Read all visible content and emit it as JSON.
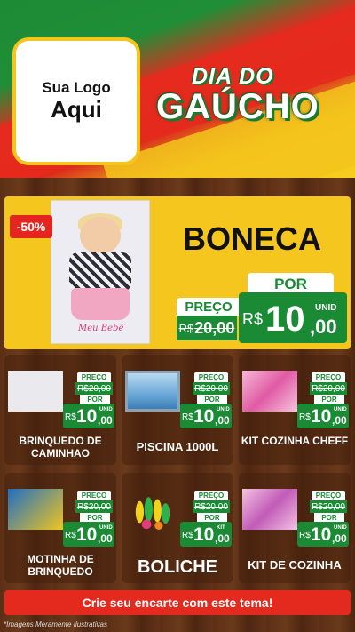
{
  "header": {
    "logo_line1": "Sua Logo",
    "logo_line2": "Aqui",
    "title_line1": "DIA DO",
    "title_line2": "GAÚCHO"
  },
  "hero": {
    "discount": "-50%",
    "name": "BONECA",
    "brand_text": "Meu Bebê",
    "preco_label": "PREÇO",
    "old_currency": "R$",
    "old_price": "20,00",
    "por_label": "POR",
    "currency": "R$",
    "price_int": "10",
    "price_cents": ",00",
    "unit": "UNID"
  },
  "cards": [
    {
      "name": "BRINQUEDO DE CAMINHAO",
      "preco_label": "PREÇO",
      "old_currency": "R$",
      "old_price": "20,00",
      "por_label": "POR",
      "currency": "R$",
      "price_int": "10",
      "price_cents": ",00",
      "unit": "UNID"
    },
    {
      "name": "PISCINA 1000L",
      "preco_label": "PREÇO",
      "old_currency": "R$",
      "old_price": "20,00",
      "por_label": "POR",
      "currency": "R$",
      "price_int": "10",
      "price_cents": ",00",
      "unit": "UNID"
    },
    {
      "name": "KIT COZINHA CHEFF",
      "preco_label": "PREÇO",
      "old_currency": "R$",
      "old_price": "20,00",
      "por_label": "POR",
      "currency": "R$",
      "price_int": "10",
      "price_cents": ",00",
      "unit": "UNID"
    },
    {
      "name": "MOTINHA DE BRINQUEDO",
      "preco_label": "PREÇO",
      "old_currency": "R$",
      "old_price": "20,00",
      "por_label": "POR",
      "currency": "R$",
      "price_int": "10",
      "price_cents": ",00",
      "unit": "UNID"
    },
    {
      "name": "BOLICHE",
      "preco_label": "PREÇO",
      "old_currency": "R$",
      "old_price": "20,00",
      "por_label": "POR",
      "currency": "R$",
      "price_int": "10",
      "price_cents": ",00",
      "unit": "KIT"
    },
    {
      "name": "KIT DE COZINHA",
      "preco_label": "PREÇO",
      "old_currency": "R$",
      "old_price": "20,00",
      "por_label": "POR",
      "currency": "R$",
      "price_int": "10",
      "price_cents": ",00",
      "unit": "UNID"
    }
  ],
  "cta": "Crie seu encarte com este tema!",
  "disclaimer": "*Imagens Meramente Ilustrativas",
  "colors": {
    "green": "#1a8a34",
    "red": "#e42a1f",
    "yellow": "#f5c61d",
    "wood": "#5c2f15"
  }
}
